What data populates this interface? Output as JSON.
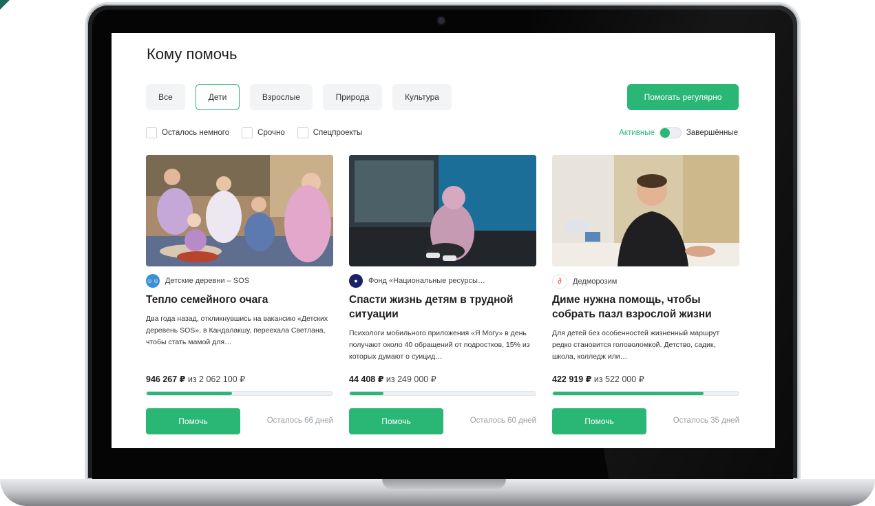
{
  "page": {
    "title": "Кому помочь"
  },
  "tabs": [
    {
      "label": "Все",
      "active": false
    },
    {
      "label": "Дети",
      "active": true
    },
    {
      "label": "Взрослые",
      "active": false
    },
    {
      "label": "Природа",
      "active": false
    },
    {
      "label": "Культура",
      "active": false
    }
  ],
  "regular_button": {
    "label": "Помогать регулярно"
  },
  "filters": [
    {
      "label": "Осталось немного",
      "checked": false
    },
    {
      "label": "Срочно",
      "checked": false
    },
    {
      "label": "Спецпроекты",
      "checked": false
    }
  ],
  "status_toggle": {
    "active_label": "Активные",
    "completed_label": "Завершённые",
    "state": "active"
  },
  "cards": [
    {
      "org": "Детские деревни – SOS",
      "title": "Тепло семейного очага",
      "description": "Два года назад, откликнувшись на вакансию «Детских деревень SOS», в Кандалакшу, переехала Светлана, чтобы стать мамой для…",
      "raised": "946 267 ₽",
      "goal_text": "из 2 062 100 ₽",
      "progress": 0.46,
      "button": "Помочь",
      "days_left": "Осталось 66 дней"
    },
    {
      "org": "Фонд «Национальные ресурсы…",
      "title": "Спасти жизнь детям в трудной ситуации",
      "description": "Психологи мобильного приложения «Я Могу» в день получают около 40 обращений от подростков, 15% из которых думают о суицид…",
      "raised": "44 408 ₽",
      "goal_text": "из 249 000 ₽",
      "progress": 0.18,
      "button": "Помочь",
      "days_left": "Осталось 60 дней"
    },
    {
      "org": "Дедморозим",
      "title": "Диме нужна помощь, чтобы собрать пазл взрослой жизни",
      "description": "Для детей без особенностей жизненный маршрут редко становится головоломкой. Детство, садик, школа, колледж или…",
      "raised": "422 919 ₽",
      "goal_text": "из 522 000 ₽",
      "progress": 0.81,
      "button": "Помочь",
      "days_left": "Осталось 35 дней"
    }
  ],
  "colors": {
    "accent": "#2ab775",
    "text": "#1f1f1f",
    "muted": "#9aa0a6",
    "tab_bg": "#f2f4f6"
  },
  "icons": [
    "camera-icon",
    "sos-logo-icon",
    "yamogu-logo-icon",
    "dedmorozim-logo-icon"
  ]
}
